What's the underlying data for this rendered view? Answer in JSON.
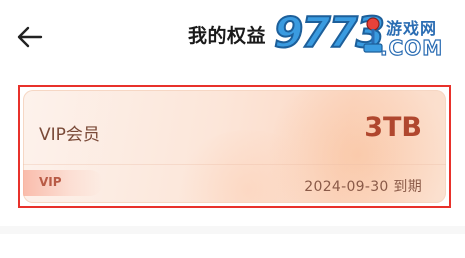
{
  "header": {
    "back_icon": "arrow-left-icon",
    "title": "我的权益"
  },
  "watermark": {
    "number": "9773",
    "site_cn": "游戏网",
    "site_com": ".COM",
    "icon": "joystick-icon"
  },
  "vip_card": {
    "title": "VIP会员",
    "quota": "3TB",
    "tag": "VIP",
    "expiry": "2024-09-30 到期"
  },
  "colors": {
    "highlight_border": "#e8312b",
    "quota_text": "#b0472e",
    "card_bg": "#fce6d9"
  }
}
